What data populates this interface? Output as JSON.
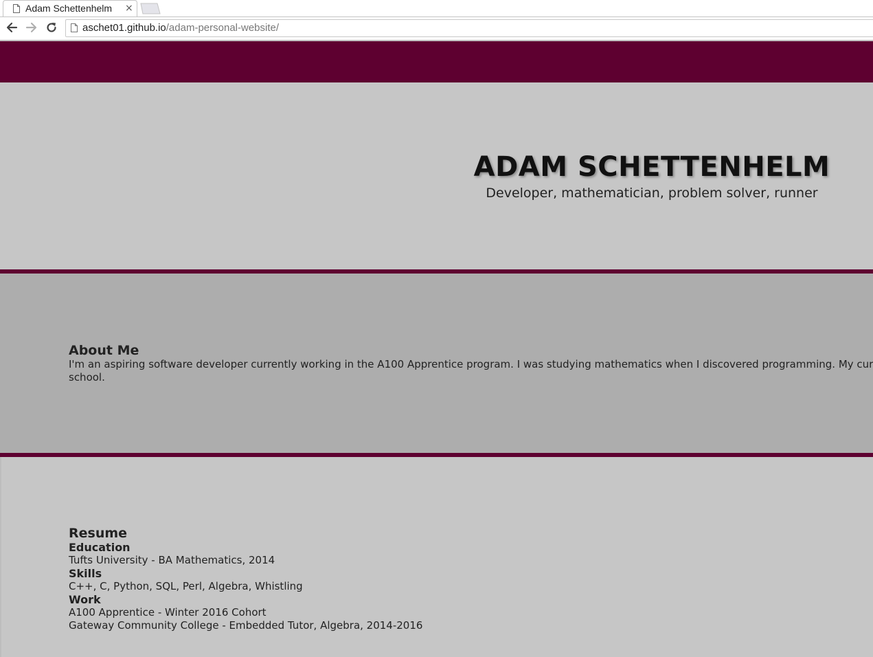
{
  "browser": {
    "tab_title": "Adam Schettenhelm",
    "tab_close": "×",
    "url_host": "aschet01.github.io",
    "url_path": "/adam-personal-website/"
  },
  "colors": {
    "accent": "#5e0030",
    "hero_bg": "#c6c6c6",
    "about_bg": "#adadad"
  },
  "hero": {
    "title": "ADAM SCHETTENHELM",
    "subtitle": "Developer, mathematician, problem solver, runner"
  },
  "about": {
    "heading": "About Me",
    "text": "I'm an aspiring software developer currently working in the A100 Apprentice program. I was studying mathematics when I discovered programming. My current plan before considering graduate school."
  },
  "resume": {
    "heading": "Resume",
    "education_heading": "Education",
    "education_items": [
      "Tufts University - BA Mathematics, 2014"
    ],
    "skills_heading": "Skills",
    "skills_items": [
      "C++, C, Python, SQL, Perl, Algebra, Whistling"
    ],
    "work_heading": "Work",
    "work_items": [
      "A100 Apprentice - Winter 2016 Cohort",
      "Gateway Community College - Embedded Tutor, Algebra, 2014-2016"
    ]
  }
}
